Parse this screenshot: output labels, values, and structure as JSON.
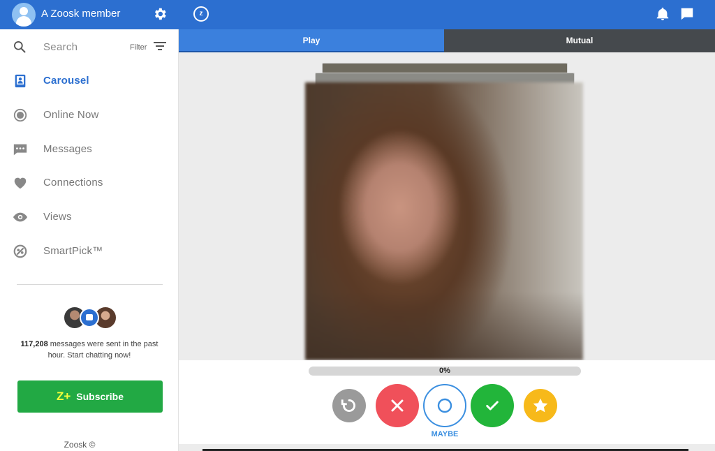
{
  "header": {
    "username": "A Zoosk member",
    "icons": [
      "avatar-icon",
      "gear-icon",
      "zoosk-logo-icon",
      "bell-icon",
      "chat-icon"
    ]
  },
  "sidebar": {
    "search_label": "Search",
    "filter_label": "Filter",
    "items": [
      {
        "label": "Carousel",
        "icon": "carousel-icon",
        "active": true
      },
      {
        "label": "Online Now",
        "icon": "online-now-icon",
        "active": false
      },
      {
        "label": "Messages",
        "icon": "messages-icon",
        "active": false
      },
      {
        "label": "Connections",
        "icon": "heart-icon",
        "active": false
      },
      {
        "label": "Views",
        "icon": "eye-icon",
        "active": false
      },
      {
        "label": "SmartPick™",
        "icon": "smartpick-icon",
        "active": false
      }
    ],
    "promo": {
      "count": "117,208",
      "text": " messages were sent in the past hour. Start chatting now!"
    },
    "subscribe_label": "Subscribe",
    "footer": "Zoosk ©"
  },
  "main": {
    "tabs": [
      {
        "label": "Play",
        "active": true
      },
      {
        "label": "Mutual",
        "active": false
      }
    ],
    "progress": {
      "value": 0,
      "text": "0%"
    },
    "maybe_label": "MAYBE",
    "colors": {
      "brand": "#2c6fd0",
      "no": "#f0505a",
      "yes": "#22b53a",
      "favorite": "#f7b91a",
      "undo": "#9a9a9a",
      "subscribe": "#22a944"
    }
  }
}
